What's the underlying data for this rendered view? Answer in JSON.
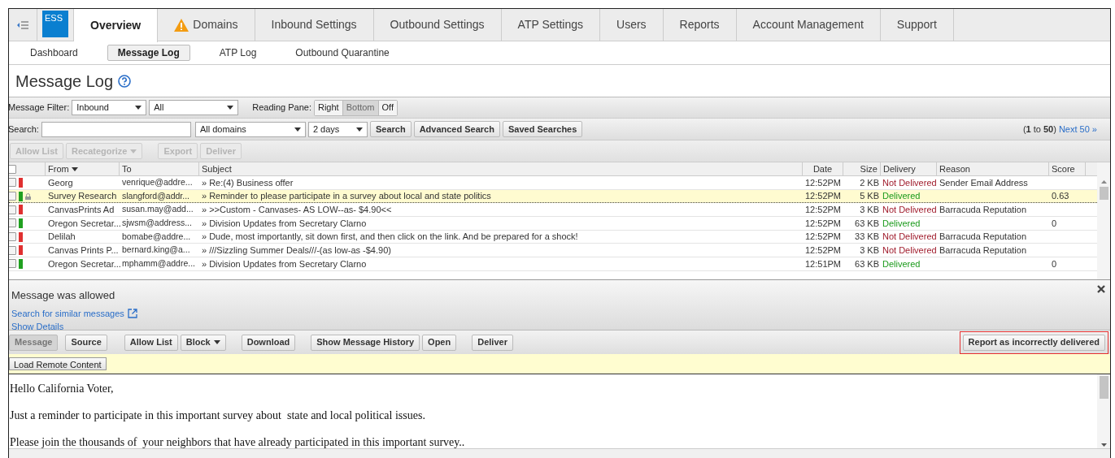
{
  "logo": {
    "text": "ESS"
  },
  "tabs": [
    {
      "label": "Overview",
      "selected": true,
      "warning": false
    },
    {
      "label": "Domains",
      "selected": false,
      "warning": true
    },
    {
      "label": "Inbound Settings",
      "selected": false,
      "warning": false
    },
    {
      "label": "Outbound Settings",
      "selected": false,
      "warning": false
    },
    {
      "label": "ATP Settings",
      "selected": false,
      "warning": false
    },
    {
      "label": "Users",
      "selected": false,
      "warning": false
    },
    {
      "label": "Reports",
      "selected": false,
      "warning": false
    },
    {
      "label": "Account Management",
      "selected": false,
      "warning": false
    },
    {
      "label": "Support",
      "selected": false,
      "warning": false
    }
  ],
  "subtabs": [
    {
      "label": "Dashboard",
      "selected": false
    },
    {
      "label": "Message Log",
      "selected": true
    },
    {
      "label": "ATP Log",
      "selected": false
    },
    {
      "label": "Outbound Quarantine",
      "selected": false
    }
  ],
  "page_title": "Message Log",
  "filter_bar": {
    "label": "Message Filter:",
    "direction": "Inbound",
    "category": "All",
    "reading_pane_label": "Reading Pane:",
    "reading_pane": [
      {
        "label": "Right",
        "selected": false
      },
      {
        "label": "Bottom",
        "selected": true
      },
      {
        "label": "Off",
        "selected": false
      }
    ]
  },
  "search_bar": {
    "label": "Search:",
    "domains": "All domains",
    "range": "2 days",
    "buttons": [
      "Search",
      "Advanced Search",
      "Saved Searches"
    ],
    "range_text": "(**1** to **50**)",
    "next": "Next 50 »"
  },
  "actions": [
    {
      "label": "Allow List",
      "disabled": true,
      "dropdown": false
    },
    {
      "label": "Recategorize",
      "disabled": true,
      "dropdown": true
    },
    {
      "label": "Export",
      "disabled": true,
      "dropdown": false
    },
    {
      "label": "Deliver",
      "disabled": true,
      "dropdown": false
    }
  ],
  "table": {
    "select_all_checked": false,
    "columns": [
      "From",
      "To",
      "Subject",
      "Date",
      "Size",
      "Delivery",
      "Reason",
      "Score"
    ],
    "rows": [
      {
        "from": "Georg",
        "to": "venrique@addre...",
        "subject": "» Re:(4) Business offer",
        "date": "12:52PM",
        "size": "2 KB",
        "delivery": "Not Delivered",
        "delivered": false,
        "reason": "Sender Email Address",
        "score": "",
        "color": "#e03030",
        "locked": false,
        "selected": false
      },
      {
        "from": "Survey Research",
        "to": "slangford@addr...",
        "subject": "» Reminder to please participate in a survey about local and state politics",
        "date": "12:52PM",
        "size": "5 KB",
        "delivery": "Delivered",
        "delivered": true,
        "reason": "",
        "score": "0.63",
        "color": "#20a020",
        "locked": true,
        "selected": true
      },
      {
        "from": "CanvasPrints Ad",
        "to": "susan.may@add...",
        "subject": "» >>Custom - Canvases- AS LOW--as- $4.90<<",
        "date": "12:52PM",
        "size": "3 KB",
        "delivery": "Not Delivered",
        "delivered": false,
        "reason": "Barracuda Reputation",
        "score": "",
        "color": "#e03030",
        "locked": false,
        "selected": false
      },
      {
        "from": "Oregon Secretar...",
        "to": "sjwsm@address...",
        "subject": "» Division Updates from Secretary Clarno",
        "date": "12:52PM",
        "size": "63 KB",
        "delivery": "Delivered",
        "delivered": true,
        "reason": "",
        "score": "0",
        "color": "#20a020",
        "locked": false,
        "selected": false
      },
      {
        "from": "Delilah",
        "to": "bomabe@addre...",
        "subject": "» Dude, most importantly, sit down first, and then click on the link. And be prepared for a shock!",
        "date": "12:52PM",
        "size": "33 KB",
        "delivery": "Not Delivered",
        "delivered": false,
        "reason": "Barracuda Reputation",
        "score": "",
        "color": "#e03030",
        "locked": false,
        "selected": false
      },
      {
        "from": "Canvas Prints P...",
        "to": "bernard.king@a...",
        "subject": "» ///Sizzling Summer Deals///-(as low-as -$4.90)",
        "date": "12:52PM",
        "size": "3 KB",
        "delivery": "Not Delivered",
        "delivered": false,
        "reason": "Barracuda Reputation",
        "score": "",
        "color": "#e03030",
        "locked": false,
        "selected": false
      },
      {
        "from": "Oregon Secretar...",
        "to": "mphamm@addre...",
        "subject": "» Division Updates from Secretary Clarno",
        "date": "12:51PM",
        "size": "63 KB",
        "delivery": "Delivered",
        "delivered": true,
        "reason": "",
        "score": "0",
        "color": "#20a020",
        "locked": false,
        "selected": false
      }
    ]
  },
  "detail": {
    "status": "Message was allowed",
    "search_link": "Search for similar messages",
    "details_link": "Show Details"
  },
  "message_toolbar": [
    {
      "label": "Message",
      "selected": true,
      "dropdown": false
    },
    {
      "label": "Source",
      "selected": false,
      "dropdown": false
    },
    {
      "label": "Allow List",
      "selected": false,
      "dropdown": false
    },
    {
      "label": "Block",
      "selected": false,
      "dropdown": true
    },
    {
      "label": "Download",
      "selected": false,
      "dropdown": false
    },
    {
      "label": "Show Message History",
      "selected": false,
      "dropdown": false
    },
    {
      "label": "Open",
      "selected": false,
      "dropdown": false
    },
    {
      "label": "Deliver",
      "selected": false,
      "dropdown": false
    }
  ],
  "report_button": {
    "label": "Report as incorrectly delivered",
    "highlighted": true
  },
  "load_remote_button": "Load Remote Content",
  "message_body": [
    "Hello California Voter,",
    "Just a reminder to participate in this important survey about  state and local political issues.",
    "Please join the thousands of  your neighbors that have already participated in this important survey.."
  ]
}
